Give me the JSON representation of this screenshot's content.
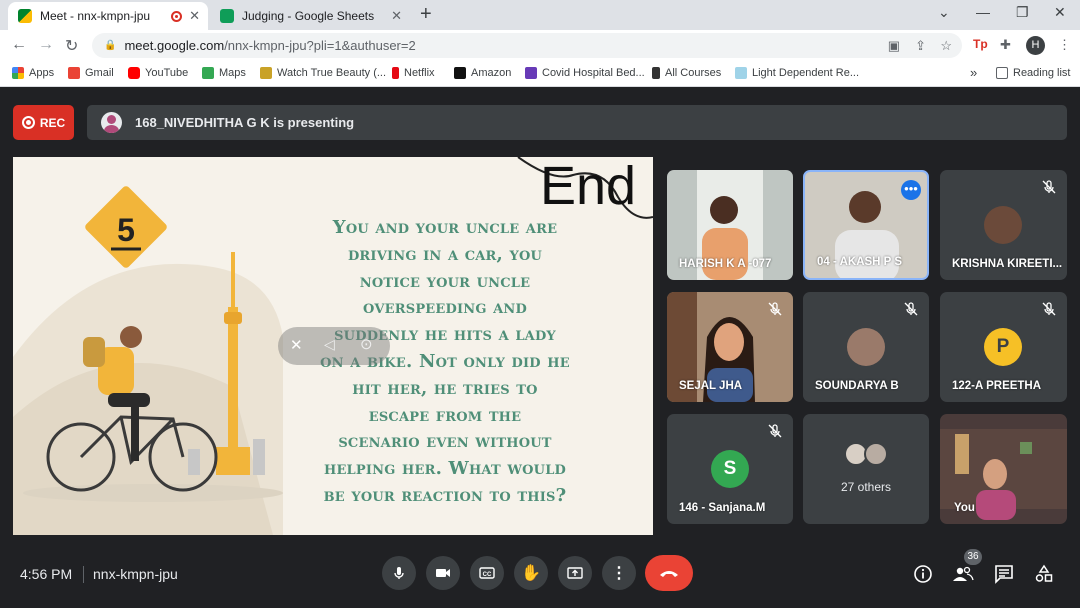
{
  "browser": {
    "tabs": [
      {
        "title": "Meet - nnx-kmpn-jpu",
        "close": "✕"
      },
      {
        "title": "Judging - Google Sheets",
        "close": "✕"
      }
    ],
    "url_host": "meet.google.com",
    "url_path": "/nnx-kmpn-jpu?pli=1&authuser=2",
    "profile_initial": "H",
    "bookmarks": [
      {
        "label": "Apps",
        "color": "#4285f4"
      },
      {
        "label": "Gmail",
        "color": "#ea4335"
      },
      {
        "label": "YouTube",
        "color": "#ff0000"
      },
      {
        "label": "Maps",
        "color": "#34a853"
      },
      {
        "label": "Watch True Beauty (...",
        "color": "#c9a227"
      },
      {
        "label": "Netflix",
        "color": "#e50914"
      },
      {
        "label": "Amazon",
        "color": "#111111"
      },
      {
        "label": "Covid Hospital Bed...",
        "color": "#673ab7"
      },
      {
        "label": "All Courses",
        "color": "#333333"
      },
      {
        "label": "Light Dependent Re...",
        "color": "#9fd3e8"
      }
    ],
    "more": "»",
    "reading_list": "Reading list"
  },
  "meet": {
    "rec_label": "REC",
    "presenting_text": "168_NIVEDHITHA G K is presenting",
    "slide": {
      "number": "5",
      "end_word": "End",
      "lines": [
        "You and your uncle are",
        "driving in a car, you",
        "notice your uncle",
        "overspeeding and",
        "suddenly he hits a lady",
        "on a bike. Not only did he",
        "hit her, he tries to",
        "escape from the",
        "scenario even without",
        "helping her. What would",
        "be your reaction to this?"
      ]
    },
    "participants": [
      {
        "name": "HARISH K A -077"
      },
      {
        "name": "04 - AKASH P S"
      },
      {
        "name": "KRISHNA KIREETI..."
      },
      {
        "name": "SEJAL JHA"
      },
      {
        "name": "SOUNDARYA B"
      },
      {
        "name": "122-A PREETHA",
        "initial": "P",
        "color": "#f6c026"
      },
      {
        "name": "146 - Sanjana.M",
        "initial": "S",
        "color": "#33a852"
      },
      {
        "name": "27 others"
      },
      {
        "name": "You"
      }
    ],
    "time": "4:56 PM",
    "meeting_code": "nnx-kmpn-jpu",
    "people_count": "36"
  }
}
